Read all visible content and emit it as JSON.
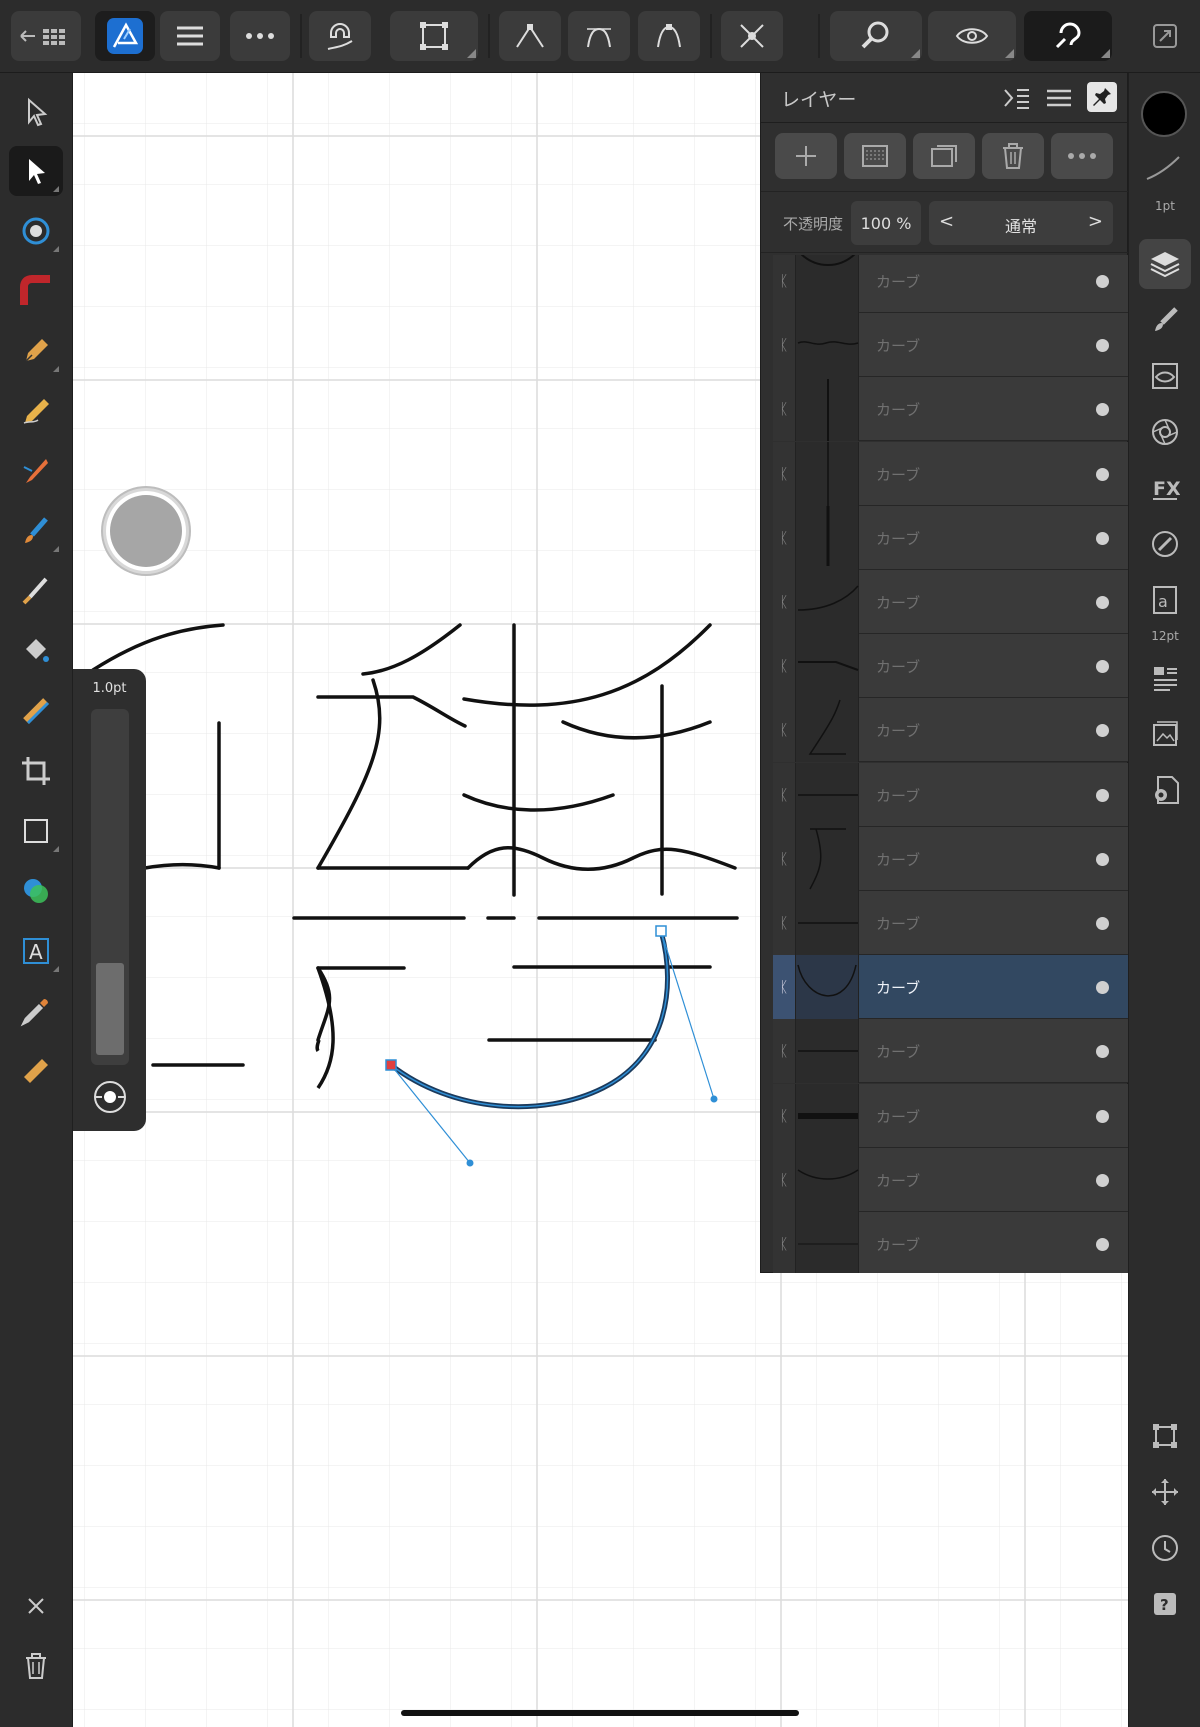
{
  "app": {
    "name": "Affinity Designer"
  },
  "toolbar": {
    "buttons": [
      "back-grid",
      "persona",
      "menu",
      "more",
      "snapping",
      "transform",
      "sharp-corner",
      "smooth-corner",
      "smart-corner",
      "break-curve",
      "zoom",
      "view-mode",
      "assistant",
      "fullscreen"
    ]
  },
  "left_tools": [
    "move",
    "node",
    "corner",
    "pen",
    "pencil",
    "brush",
    "vector-brush",
    "paint",
    "fill",
    "transparency",
    "crop",
    "rectangle",
    "shape-builder",
    "artistic-text",
    "color-picker",
    "measure"
  ],
  "layers_panel": {
    "title": "レイヤー",
    "opacity_label": "不透明度",
    "opacity_value": "100 %",
    "blend_mode": "通常",
    "blend_prev": "<",
    "blend_next": ">",
    "layers": [
      {
        "name": "カーブ",
        "selected": false
      },
      {
        "name": "カーブ",
        "selected": false
      },
      {
        "name": "カーブ",
        "selected": false
      },
      {
        "name": "カーブ",
        "selected": false
      },
      {
        "name": "カーブ",
        "selected": false
      },
      {
        "name": "カーブ",
        "selected": false
      },
      {
        "name": "カーブ",
        "selected": false
      },
      {
        "name": "カーブ",
        "selected": false
      },
      {
        "name": "カーブ",
        "selected": false
      },
      {
        "name": "カーブ",
        "selected": false
      },
      {
        "name": "カーブ",
        "selected": false
      },
      {
        "name": "カーブ",
        "selected": true
      },
      {
        "name": "カーブ",
        "selected": false
      },
      {
        "name": "カーブ",
        "selected": false
      },
      {
        "name": "カーブ",
        "selected": false
      },
      {
        "name": "カーブ",
        "selected": false
      }
    ]
  },
  "right_studio": {
    "stroke_width_label": "1pt",
    "text_size_label": "12pt",
    "items": [
      "layers",
      "brushes",
      "appearance",
      "transparency",
      "fx",
      "color",
      "text-styles",
      "align",
      "stock",
      "settings"
    ]
  },
  "stroke_popup": {
    "label": "1.0pt"
  },
  "colors": {
    "accent": "#2f8fd6",
    "selection_row": "#324861",
    "ui_dark": "#2c2c2c"
  }
}
